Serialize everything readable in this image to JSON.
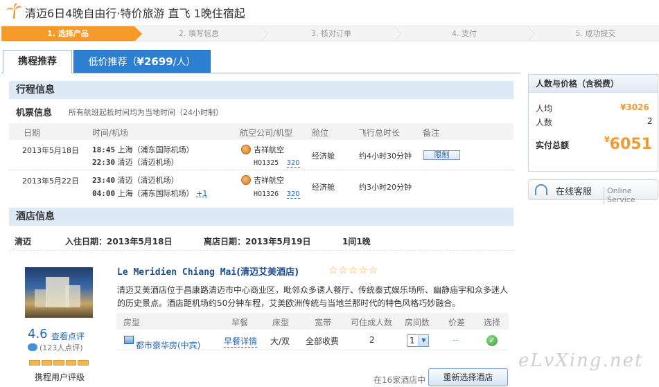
{
  "header": {
    "title": "清迈6日4晚自由行·特价旅游 直飞 1晚住宿起"
  },
  "steps": [
    "1. 选择产品",
    "2. 填写信息",
    "3. 核对订单",
    "4. 支付",
    "5. 成功提交"
  ],
  "tabs": {
    "tab1": "携程推荐",
    "tab2_prefix": "低价推荐（",
    "tab2_price": "¥2699",
    "tab2_suffix": "/人）"
  },
  "itinerary": {
    "title": "行程信息",
    "ticket_title": "机票信息",
    "ticket_note": "所有航班起抵时间均为当地时间（24小时制）",
    "columns": [
      "日期",
      "时间/机场",
      "航空公司/机型",
      "舱位",
      "飞行总时长",
      "备注"
    ],
    "flights": [
      {
        "date": "2013年5月18日",
        "dep_time": "18:45",
        "dep_airport": "上海（浦东国际机场）",
        "arr_time": "22:30",
        "arr_airport": "清迈（清迈机场）",
        "plus": "",
        "airline": "吉祥航空",
        "flight_no": "HO1325",
        "plane": "320",
        "cabin": "经济舱",
        "duration": "约4小时30分钟",
        "note": "限制"
      },
      {
        "date": "2013年5月22日",
        "dep_time": "23:40",
        "dep_airport": "清迈（清迈机场）",
        "arr_time": "04:00",
        "arr_airport": "上海（浦东国际机场）",
        "plus": "+1",
        "airline": "吉祥航空",
        "flight_no": "HO1326",
        "plane": "320",
        "cabin": "经济舱",
        "duration": "约3小时20分钟",
        "note": ""
      }
    ]
  },
  "hotel": {
    "title": "酒店信息",
    "city": "清迈",
    "checkin": "入住日期：2013年5月18日",
    "checkout": "离店日期：2013年5月19日",
    "nights": "1间1晚",
    "name_en": "Le Meridien Chiang Mai",
    "name_cn": "(清迈艾美酒店)",
    "stars": "☆☆☆☆☆",
    "description": "清迈艾美酒店位于昌康路清迈市中心商业区，毗邻众多诱人餐厅、传统泰式娱乐场所、幽静庙宇和众多迷人的历史景点。酒店距机场约50分钟车程，艾美欧洲传统与当地兰那时代的特色风格巧妙融合。",
    "score": "4.6",
    "score_link": "查看点评",
    "review_count": "(123人点评)",
    "rating_label": "携程用户评级",
    "room_columns": [
      "房型",
      "早餐",
      "床型",
      "宽带",
      "可住成人数",
      "房间数",
      "价差",
      "选择"
    ],
    "room": {
      "type": "都市豪华房(中宾)",
      "breakfast": "早餐详情",
      "bed": "大/双",
      "broadband": "全部收费",
      "adults": "2",
      "qty": "1",
      "diff": "--"
    },
    "count_note": "在16家酒店中",
    "reselect": "重新选择酒店"
  },
  "price_panel": {
    "title": "人数与价格（含税费）",
    "per_person_label": "人均",
    "per_person": "¥3026",
    "people_label": "人数",
    "people": "2",
    "total_label": "实付总额",
    "total_symbol": "¥",
    "total": "6051"
  },
  "service": {
    "label": "在线客服",
    "label_en": "Online Service"
  },
  "watermark": "eLvXing.net"
}
